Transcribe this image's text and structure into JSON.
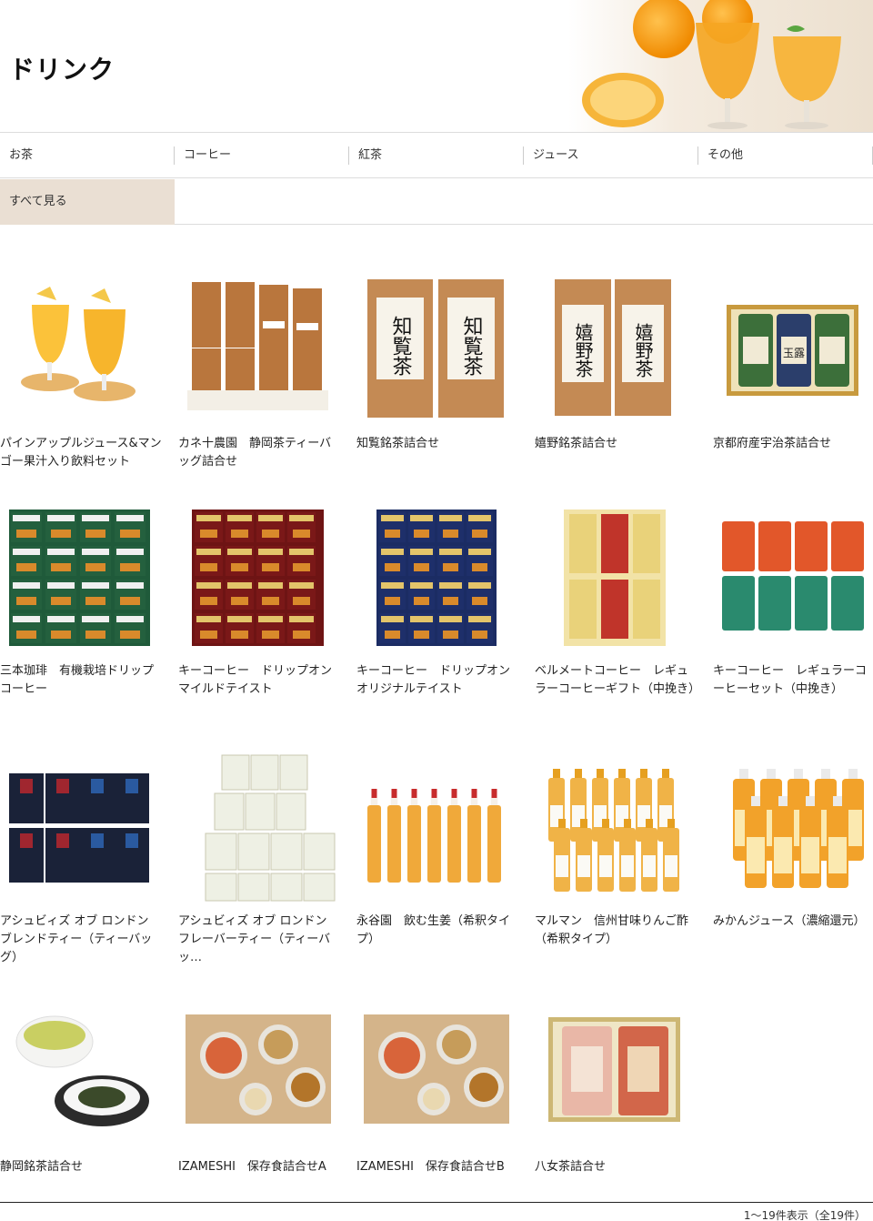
{
  "header": {
    "title": "ドリンク"
  },
  "categories": [
    "お茶",
    "コーヒー",
    "紅茶",
    "ジュース",
    "その他"
  ],
  "view_all": "すべて見る",
  "products": [
    {
      "name": "パインアップルジュース&マンゴー果汁入り飲料セット",
      "image": "pineapple-juice-glasses"
    },
    {
      "name": "カネ十農園　静岡茶ティーバッグ詰合せ",
      "image": "tea-bag-packs"
    },
    {
      "name": "知覧銘茶詰合せ",
      "image": "chiran-tea-bags",
      "label": "知覧茶"
    },
    {
      "name": "嬉野銘茶詰合せ",
      "image": "ureshino-tea-bags",
      "label": "嬉野茶"
    },
    {
      "name": "京都府産宇治茶詰合せ",
      "image": "uji-tea-cans",
      "label": "玉露"
    },
    {
      "name": "三本珈琲　有機栽培ドリップコーヒー",
      "image": "drip-top-coffee"
    },
    {
      "name": "キーコーヒー　ドリップオンマイルドテイスト",
      "image": "drip-on-mild"
    },
    {
      "name": "キーコーヒー　ドリップオンオリジナルテイスト",
      "image": "drip-on-original"
    },
    {
      "name": "ベルメートコーヒー　レギュラーコーヒーギフト（中挽き）",
      "image": "belmate-coffee"
    },
    {
      "name": "キーコーヒー　レギュラーコーヒーセット（中挽き）",
      "image": "key-coffee-cans"
    },
    {
      "name": "アシュビィズ オブ ロンドン ブレンドティー（ティーバッグ）",
      "image": "ashbys-blend-tea"
    },
    {
      "name": "アシュビィズ オブ ロンドン フレーバーティー（ティーバッ…",
      "image": "ashbys-flavor-tea"
    },
    {
      "name": "永谷園　飲む生姜（希釈タイプ）",
      "image": "ginger-drink-bottles"
    },
    {
      "name": "マルマン　信州甘味りんご酢（希釈タイプ）",
      "image": "apple-vinegar-bottles"
    },
    {
      "name": "みかんジュース（濃縮還元）",
      "image": "mikan-juice-bottles"
    },
    {
      "name": "静岡銘茶詰合せ",
      "image": "green-tea-cup"
    },
    {
      "name": "IZAMESHI　保存食詰合せA",
      "image": "izameshi-food"
    },
    {
      "name": "IZAMESHI　保存食詰合せB",
      "image": "izameshi-food"
    },
    {
      "name": "八女茶詰合せ",
      "image": "yame-tea-cans"
    }
  ],
  "result_count": "1～19件表示（全19件）",
  "colors": {
    "view_all_bg": "#eadfd3",
    "divider": "#dddddd",
    "juice": "#f5a623"
  }
}
